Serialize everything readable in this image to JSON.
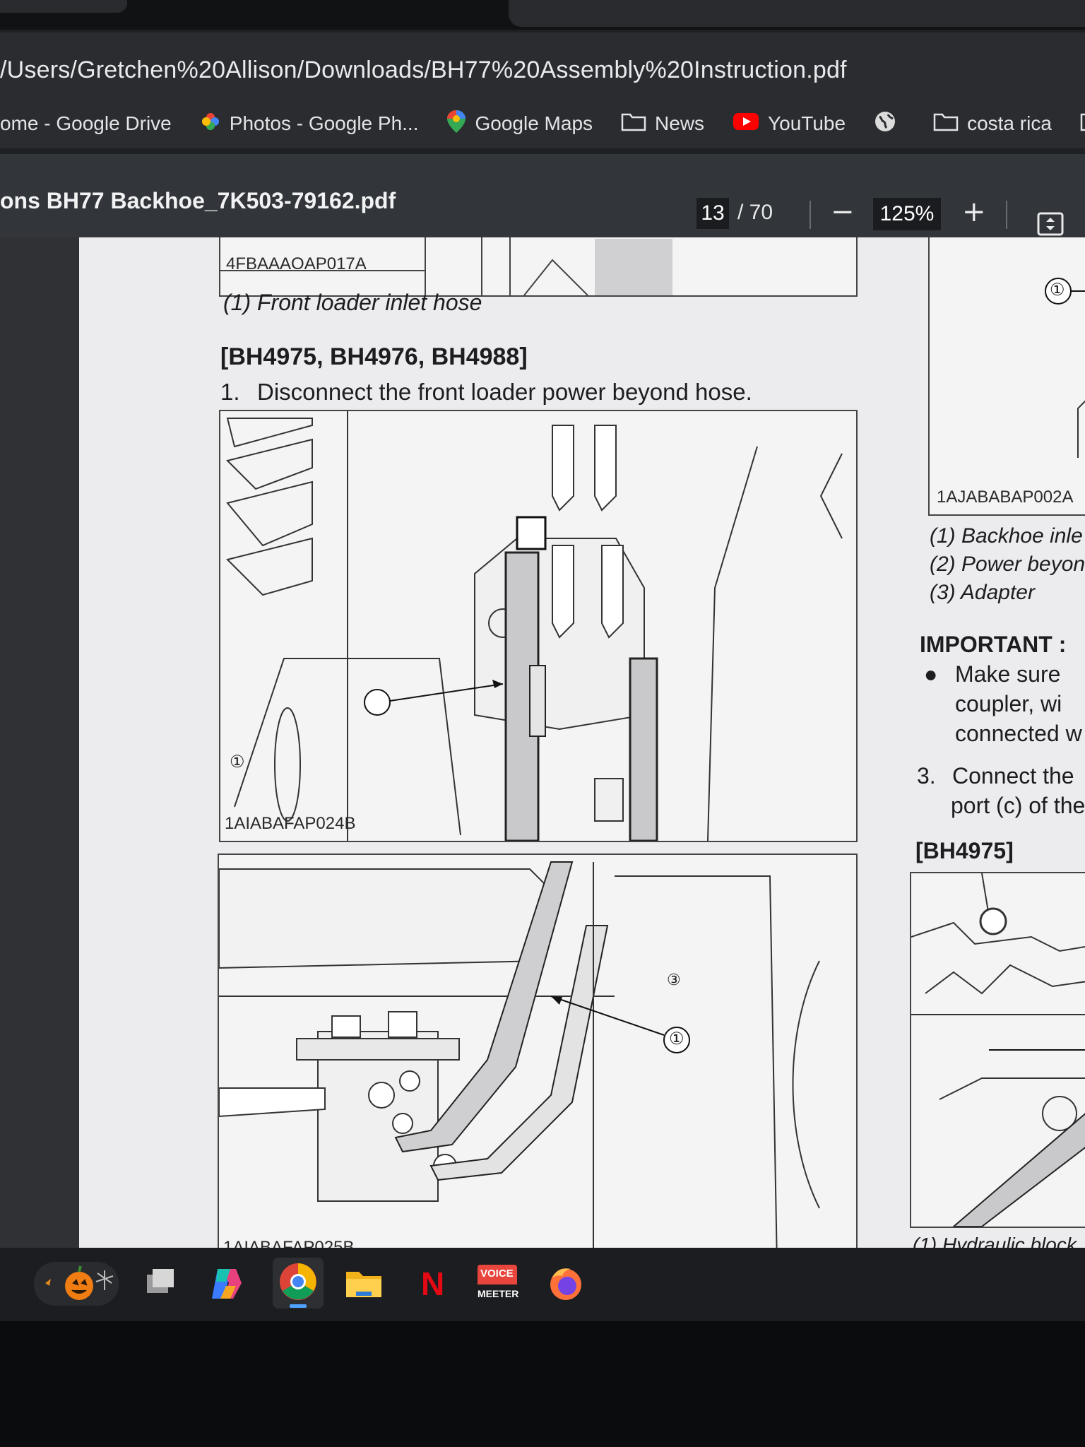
{
  "browser": {
    "url": "/Users/Gretchen%20Allison/Downloads/BH77%20Assembly%20Instruction.pdf",
    "bookmarks": [
      {
        "label": "ome - Google Drive",
        "icon": "none"
      },
      {
        "label": "Photos - Google Ph...",
        "icon": "pinwheel-icon"
      },
      {
        "label": "Google Maps",
        "icon": "map-pin-icon"
      },
      {
        "label": "News",
        "icon": "folder-icon"
      },
      {
        "label": "YouTube",
        "icon": "youtube-icon"
      },
      {
        "label": "",
        "icon": "globe-icon"
      },
      {
        "label": "costa rica",
        "icon": "folder-icon"
      }
    ]
  },
  "pdf": {
    "title": "ons BH77 Backhoe_7K503-79162.pdf",
    "page_current": "13",
    "page_total": "/ 70",
    "zoom": "125%"
  },
  "page_content": {
    "top_fig_label": "4FBAAAOAP017A",
    "caption_front_loader": "(1) Front loader inlet hose",
    "section_heading": "[BH4975, BH4976, BH4988]",
    "step1_num": "1.",
    "step1_text": "Disconnect the front loader power beyond hose.",
    "fig1_label": "1AIABAFAP024B",
    "fig1_callout": "①",
    "fig2_callout_a": "③",
    "fig2_callout_b": "①",
    "fig2_label": "1AIABAFAP025B",
    "right_col": {
      "callout_top": "①",
      "fig_label": "1AJABABAP002A",
      "list": [
        "(1) Backhoe inle",
        "(2) Power beyon",
        "(3) Adapter"
      ],
      "important": "IMPORTANT :",
      "bullet_lines": [
        "Make  sure",
        "coupler,  wi",
        "connected w"
      ],
      "step3_num": "3.",
      "step3_lines": [
        "Connect the",
        "port (c) of the"
      ],
      "sub_heading": "[BH4975]",
      "bottom_caption": "(1) Hydraulic block"
    }
  },
  "taskbar": {
    "apps": [
      "pumpkin-widget-icon",
      "task-view-icon",
      "copilot-icon",
      "chrome-icon",
      "file-explorer-icon",
      "netflix-icon",
      "voicemeeter-icon",
      "firefox-icon"
    ],
    "voicemeeter_top": "VOICE",
    "voicemeeter_bottom": "MEETER",
    "netflix_letter": "N"
  },
  "colors": {
    "page_bg": "#ececee",
    "toolbar_bg": "#323539",
    "youtube_red": "#ff0000",
    "chrome_indicator": "#4ea3ff"
  }
}
